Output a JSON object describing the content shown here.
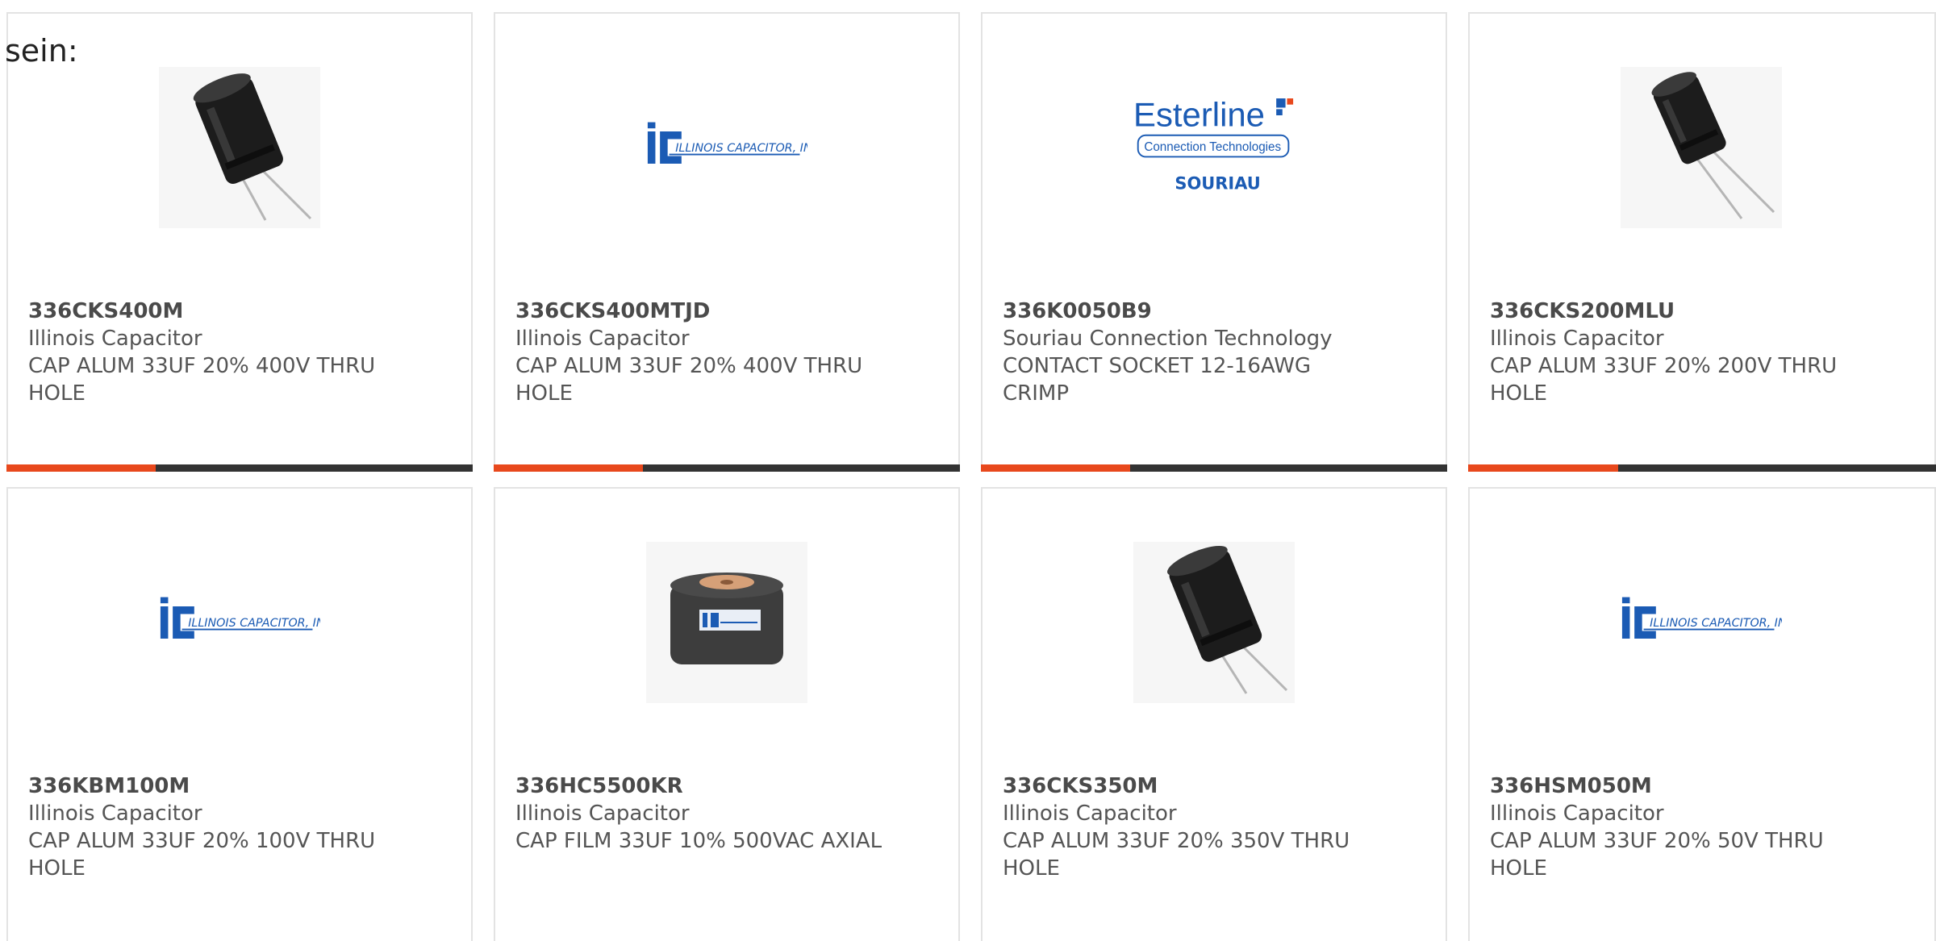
{
  "intro_text": "sein:",
  "colors": {
    "accent": "#e8481c",
    "bar": "#333333",
    "card_border": "#e3e3e3",
    "brand_blue": "#1b5bb4"
  },
  "products": [
    {
      "part_number": "336CKS400M",
      "manufacturer": "Illinois Capacitor",
      "description": "CAP ALUM 33UF 20% 400V THRU HOLE",
      "image": "radial-capacitor-photo",
      "progress": 0.32
    },
    {
      "part_number": "336CKS400MTJD",
      "manufacturer": "Illinois Capacitor",
      "description": "CAP ALUM 33UF 20% 400V THRU HOLE",
      "image": "illinois-capacitor-logo",
      "logo_text": "ILLINOIS CAPACITOR, INC.",
      "progress": 0.32
    },
    {
      "part_number": "336K0050B9",
      "manufacturer": "Souriau Connection Technology",
      "description": "CONTACT SOCKET 12-16AWG CRIMP",
      "image": "esterline-souriau-logo",
      "logo_text": [
        "Esterline",
        "Connection Technologies",
        "SOURIAU"
      ],
      "progress": 0.32
    },
    {
      "part_number": "336CKS200MLU",
      "manufacturer": "Illinois Capacitor",
      "description": "CAP ALUM 33UF 20% 200V THRU HOLE",
      "image": "radial-capacitor-photo",
      "progress": 0.32
    },
    {
      "part_number": "336KBM100M",
      "manufacturer": "Illinois Capacitor",
      "description": "CAP ALUM 33UF 20% 100V THRU HOLE",
      "image": "illinois-capacitor-logo",
      "logo_text": "ILLINOIS CAPACITOR, INC."
    },
    {
      "part_number": "336HC5500KR",
      "manufacturer": "Illinois Capacitor",
      "description": "CAP FILM 33UF 10% 500VAC AXIAL",
      "image": "film-capacitor-photo"
    },
    {
      "part_number": "336CKS350M",
      "manufacturer": "Illinois Capacitor",
      "description": "CAP ALUM 33UF 20% 350V THRU HOLE",
      "image": "radial-capacitor-photo"
    },
    {
      "part_number": "336HSM050M",
      "manufacturer": "Illinois Capacitor",
      "description": "CAP ALUM 33UF 20% 50V THRU HOLE",
      "image": "illinois-capacitor-logo",
      "logo_text": "ILLINOIS CAPACITOR, INC."
    }
  ]
}
